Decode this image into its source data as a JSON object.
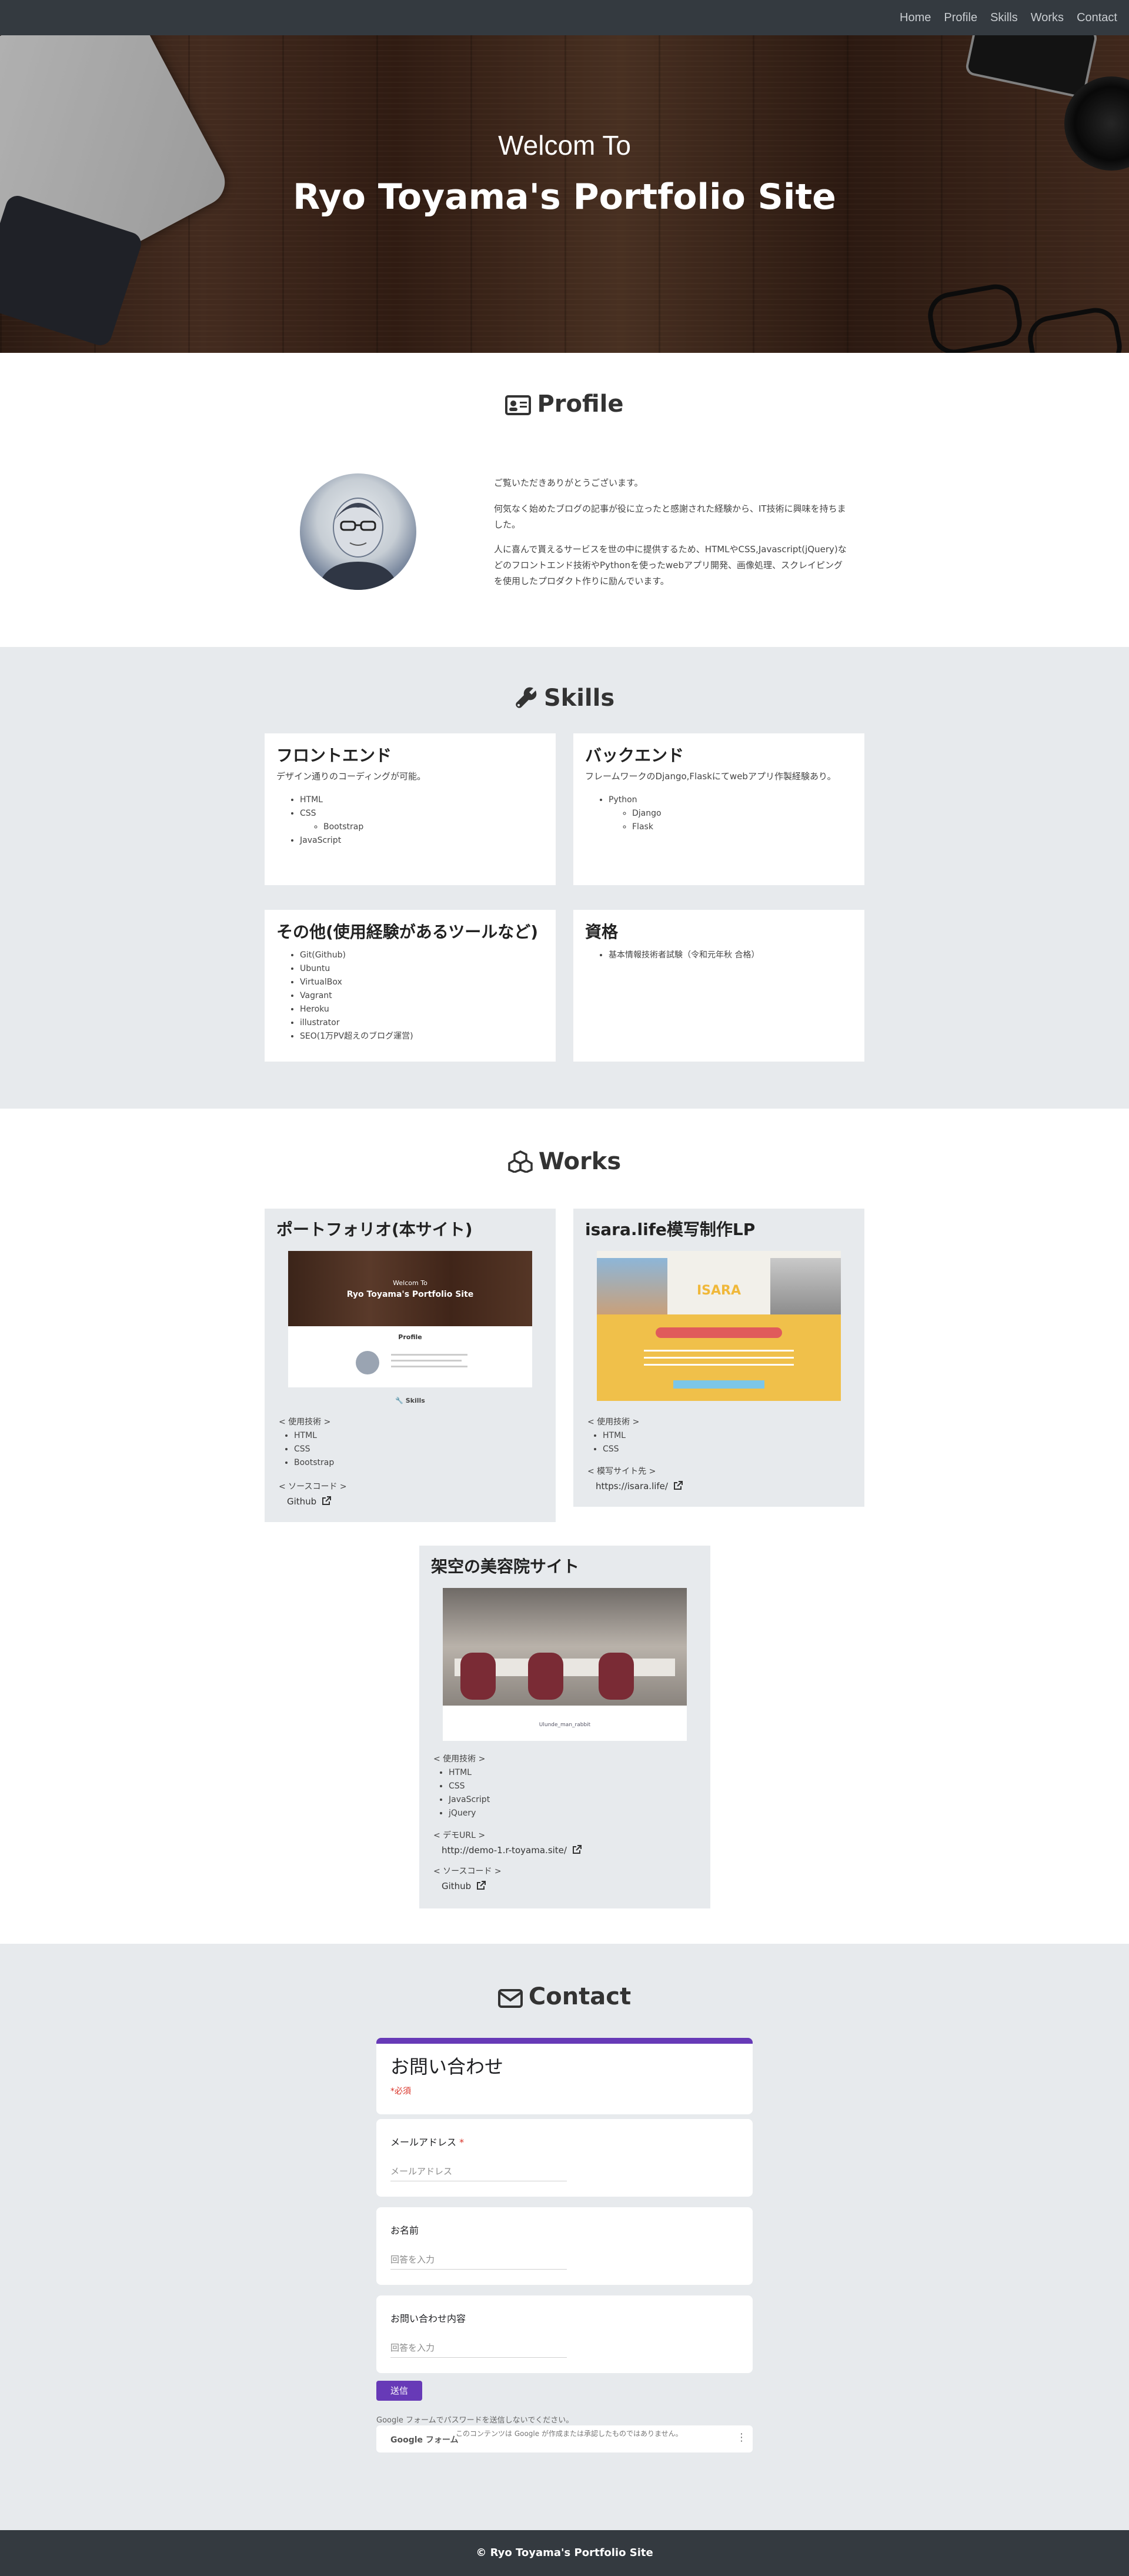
{
  "nav": {
    "items": [
      "Home",
      "Profile",
      "Skills",
      "Works",
      "Contact"
    ]
  },
  "hero": {
    "welcome": "Welcom To",
    "title": "Ryo Toyama's Portfolio Site"
  },
  "profile": {
    "heading": "Profile",
    "p1": "ご覧いただきありがとうございます。",
    "p2": "何気なく始めたブログの記事が役に立ったと感謝された経験から、IT技術に興味を持ちました。",
    "p3": "人に喜んで貰えるサービスを世の中に提供するため、HTMLやCSS,Javascript(jQuery)などのフロントエンド技術やPythonを使ったwebアプリ開発、画像処理、スクレイピングを使用したプロダクト作りに励んでいます。"
  },
  "skills": {
    "heading": "Skills",
    "frontend": {
      "title": "フロントエンド",
      "desc": "デザイン通りのコーディングが可能。",
      "items": [
        "HTML",
        "CSS",
        "Bootstrap",
        "JavaScript"
      ]
    },
    "backend": {
      "title": "バックエンド",
      "desc": "フレームワークのDjango,Flaskにてwebアプリ作製経験あり。",
      "items": [
        "Python",
        "Django",
        "Flask"
      ]
    },
    "others": {
      "title": "その他(使用経験があるツールなど)",
      "items": [
        "Git(Github)",
        "Ubuntu",
        "VirtualBox",
        "Vagrant",
        "Heroku",
        "illustrator",
        "SEO(1万PV超えのブログ運営)"
      ]
    },
    "license": {
      "title": "資格",
      "items": [
        "基本情報技術者試験（令和元年秋 合格）"
      ]
    }
  },
  "works": {
    "heading": "Works",
    "w1": {
      "title": "ポートフォリオ(本サイト)",
      "thumb_title": "Ryo Toyama's Portfolio Site",
      "thumb_welcome": "Welcom To",
      "thumb_profile": "Profile",
      "thumb_skills": "Skills",
      "tech_label": "< 使用技術 >",
      "tech": [
        "HTML",
        "CSS",
        "Bootstrap"
      ],
      "src_label": "< ソースコード >",
      "src_link": "Github"
    },
    "w2": {
      "title": "isara.life模写制作LP",
      "thumb_brand": "ISARA",
      "tech_label": "< 使用技術 >",
      "tech": [
        "HTML",
        "CSS"
      ],
      "site_label": "< 模写サイト先 >",
      "site_link": "https://isara.life/"
    },
    "w3": {
      "title": "架空の美容院サイト",
      "thumb_caption": "Ulunde_man_rabbit",
      "tech_label": "< 使用技術 >",
      "tech": [
        "HTML",
        "CSS",
        "JavaScript",
        "jQuery"
      ],
      "demo_label": "< デモURL >",
      "demo_link": "http://demo-1.r-toyama.site/",
      "src_label": "< ソースコード >",
      "src_link": "Github"
    }
  },
  "contact": {
    "heading": "Contact",
    "form_title": "お問い合わせ",
    "required_note": "*必須",
    "email_label": "メールアドレス",
    "email_required": "*",
    "email_placeholder": "メールアドレス",
    "name_label": "お名前",
    "name_placeholder": "回答を入力",
    "message_label": "お問い合わせ内容",
    "message_placeholder": "回答を入力",
    "submit": "送信",
    "notice": "Google フォームでパスワードを送信しないでください。",
    "gforms_brand": "Google フォーム",
    "gforms_disclaimer": "このコンテンツは Google が作成または承認したものではありません。"
  },
  "footer": {
    "copyright": "© Ryo Toyama's Portfolio Site"
  },
  "colors": {
    "nav_bg": "#343a40",
    "section_gray": "#e7eaed",
    "form_accent": "#673ab7"
  }
}
